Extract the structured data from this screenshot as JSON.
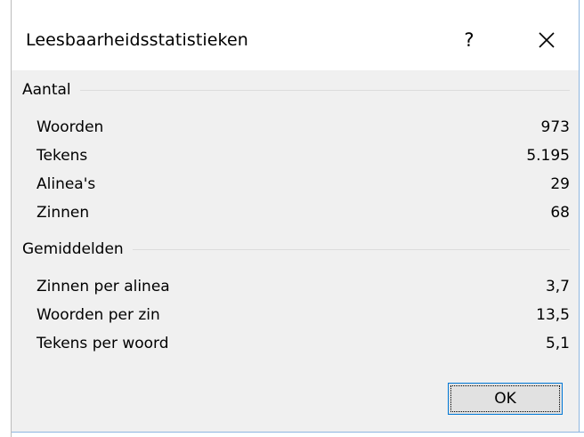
{
  "dialog": {
    "title": "Leesbaarheidsstatistieken",
    "help_label": "?",
    "close_icon": "close-icon"
  },
  "groups": {
    "counts": {
      "label": "Aantal",
      "rows": [
        {
          "label": "Woorden",
          "value": "973"
        },
        {
          "label": "Tekens",
          "value": "5.195"
        },
        {
          "label": "Alinea's",
          "value": "29"
        },
        {
          "label": "Zinnen",
          "value": "68"
        }
      ]
    },
    "averages": {
      "label": "Gemiddelden",
      "rows": [
        {
          "label": "Zinnen per alinea",
          "value": "3,7"
        },
        {
          "label": "Woorden per zin",
          "value": "13,5"
        },
        {
          "label": "Tekens per woord",
          "value": "5,1"
        }
      ]
    }
  },
  "buttons": {
    "ok_label": "OK"
  }
}
